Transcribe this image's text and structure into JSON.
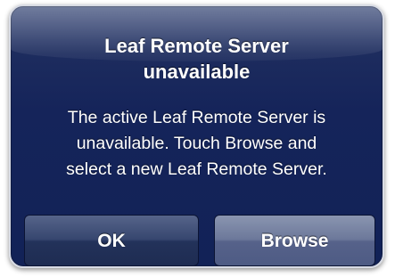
{
  "alert": {
    "title_line1": "Leaf Remote Server",
    "title_line2": "unavailable",
    "message_line1": "The active Leaf Remote Server is",
    "message_line2": "unavailable. Touch Browse and",
    "message_line3": "select a new Leaf Remote Server.",
    "buttons": {
      "ok_label": "OK",
      "browse_label": "Browse"
    }
  },
  "colors": {
    "alert_background": "#15245a",
    "alert_border": "#d8dbe4",
    "text": "#ffffff",
    "ok_button": "#36466f",
    "browse_button": "#6c789a"
  }
}
